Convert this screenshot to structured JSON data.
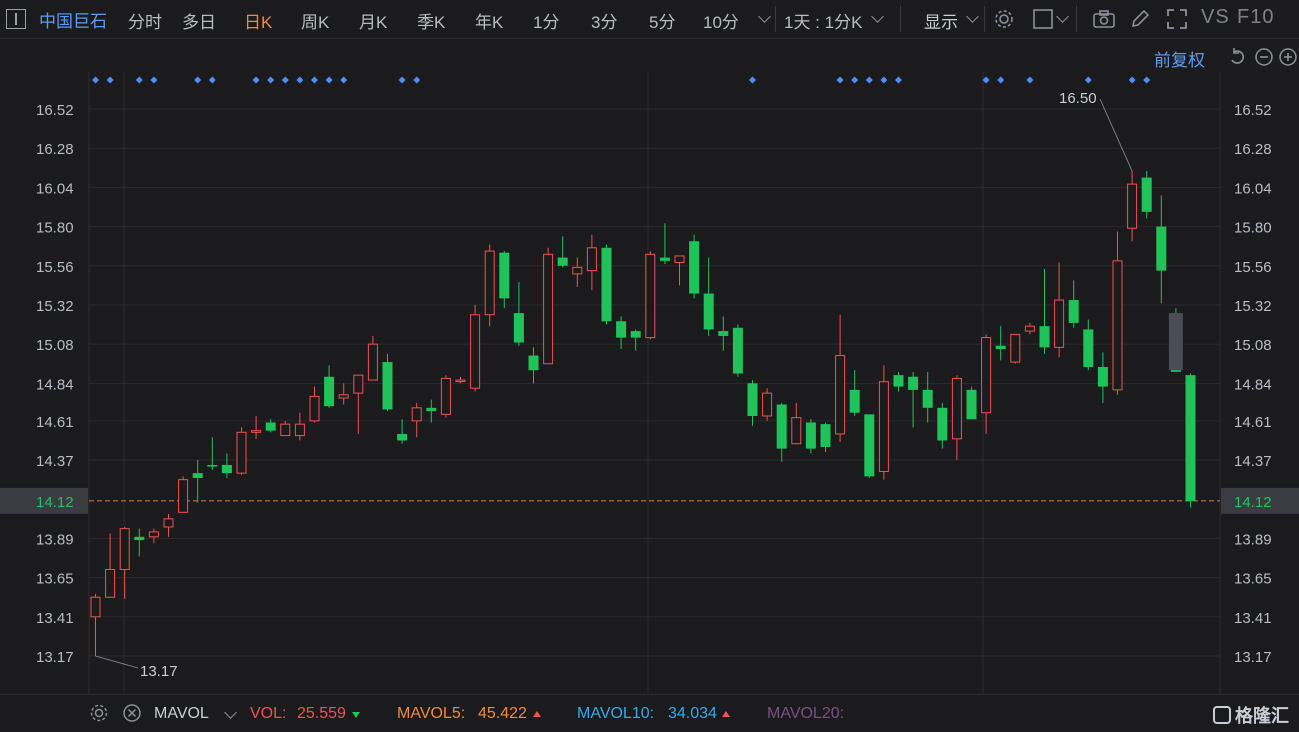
{
  "toolbar": {
    "stock_name": "中国巨石",
    "tabs": [
      "分时",
      "多日",
      "日K",
      "周K",
      "月K",
      "季K",
      "年K",
      "1分",
      "3分",
      "5分",
      "10分"
    ],
    "active_tab": "日K",
    "period_selector": "1天 : 1分K",
    "display_label": "显示",
    "vs_label": "VS",
    "f10_label": "F10"
  },
  "subheader": {
    "adjust_label": "前复权"
  },
  "colors": {
    "up": "#f0524f",
    "down": "#1fc35a",
    "grid": "#2a2b2f",
    "marker": "#4f8ef7",
    "price_line": "#e07b39",
    "price_tag_bg": "#3a3c42"
  },
  "chart_data": {
    "type": "candlestick",
    "y_ticks": [
      "16.52",
      "16.28",
      "16.04",
      "15.80",
      "15.56",
      "15.32",
      "15.08",
      "14.84",
      "14.61",
      "14.37",
      "14.12",
      "13.89",
      "13.65",
      "13.41",
      "13.17"
    ],
    "ylim": [
      13.06,
      16.69
    ],
    "current_price": "14.12",
    "high_label": "16.50",
    "low_label": "13.17",
    "marker_columns": [
      0,
      1,
      3,
      4,
      7,
      8,
      11,
      12,
      13,
      14,
      15,
      16,
      17,
      21,
      22,
      45,
      51,
      52,
      53,
      54,
      55,
      61,
      62,
      64,
      68,
      71,
      72
    ],
    "candles": [
      {
        "o": 13.41,
        "h": 13.55,
        "l": 13.17,
        "c": 13.53
      },
      {
        "o": 13.53,
        "h": 13.92,
        "l": 13.53,
        "c": 13.7
      },
      {
        "o": 13.7,
        "h": 13.96,
        "l": 13.52,
        "c": 13.95
      },
      {
        "o": 13.9,
        "h": 13.95,
        "l": 13.78,
        "c": 13.88
      },
      {
        "o": 13.9,
        "h": 13.95,
        "l": 13.86,
        "c": 13.93
      },
      {
        "o": 13.96,
        "h": 14.04,
        "l": 13.9,
        "c": 14.01
      },
      {
        "o": 14.05,
        "h": 14.27,
        "l": 14.05,
        "c": 14.25
      },
      {
        "o": 14.29,
        "h": 14.37,
        "l": 14.11,
        "c": 14.26
      },
      {
        "o": 14.34,
        "h": 14.51,
        "l": 14.31,
        "c": 14.33
      },
      {
        "o": 14.34,
        "h": 14.41,
        "l": 14.26,
        "c": 14.29
      },
      {
        "o": 14.29,
        "h": 14.57,
        "l": 14.28,
        "c": 14.54
      },
      {
        "o": 14.54,
        "h": 14.64,
        "l": 14.5,
        "c": 14.55
      },
      {
        "o": 14.6,
        "h": 14.62,
        "l": 14.54,
        "c": 14.55
      },
      {
        "o": 14.52,
        "h": 14.61,
        "l": 14.52,
        "c": 14.59
      },
      {
        "o": 14.52,
        "h": 14.66,
        "l": 14.49,
        "c": 14.59
      },
      {
        "o": 14.61,
        "h": 14.82,
        "l": 14.6,
        "c": 14.76
      },
      {
        "o": 14.88,
        "h": 14.95,
        "l": 14.69,
        "c": 14.7
      },
      {
        "o": 14.75,
        "h": 14.84,
        "l": 14.71,
        "c": 14.77
      },
      {
        "o": 14.78,
        "h": 14.89,
        "l": 14.53,
        "c": 14.89
      },
      {
        "o": 14.86,
        "h": 15.13,
        "l": 14.86,
        "c": 15.08
      },
      {
        "o": 14.97,
        "h": 15.02,
        "l": 14.67,
        "c": 14.68
      },
      {
        "o": 14.53,
        "h": 14.62,
        "l": 14.47,
        "c": 14.49
      },
      {
        "o": 14.61,
        "h": 14.72,
        "l": 14.51,
        "c": 14.69
      },
      {
        "o": 14.69,
        "h": 14.74,
        "l": 14.6,
        "c": 14.67
      },
      {
        "o": 14.65,
        "h": 14.89,
        "l": 14.63,
        "c": 14.87
      },
      {
        "o": 14.86,
        "h": 14.88,
        "l": 14.84,
        "c": 14.86
      },
      {
        "o": 14.81,
        "h": 15.32,
        "l": 14.79,
        "c": 15.26
      },
      {
        "o": 15.26,
        "h": 15.69,
        "l": 15.19,
        "c": 15.65
      },
      {
        "o": 15.64,
        "h": 15.65,
        "l": 15.3,
        "c": 15.36
      },
      {
        "o": 15.27,
        "h": 15.46,
        "l": 15.07,
        "c": 15.09
      },
      {
        "o": 15.01,
        "h": 15.06,
        "l": 14.84,
        "c": 14.92
      },
      {
        "o": 14.96,
        "h": 15.67,
        "l": 14.96,
        "c": 15.63
      },
      {
        "o": 15.61,
        "h": 15.74,
        "l": 15.55,
        "c": 15.56
      },
      {
        "o": 15.51,
        "h": 15.61,
        "l": 15.43,
        "c": 15.55
      },
      {
        "o": 15.53,
        "h": 15.75,
        "l": 15.41,
        "c": 15.67
      },
      {
        "o": 15.67,
        "h": 15.69,
        "l": 15.2,
        "c": 15.22
      },
      {
        "o": 15.22,
        "h": 15.25,
        "l": 15.05,
        "c": 15.12
      },
      {
        "o": 15.16,
        "h": 15.17,
        "l": 15.04,
        "c": 15.12
      },
      {
        "o": 15.12,
        "h": 15.65,
        "l": 15.11,
        "c": 15.63
      },
      {
        "o": 15.61,
        "h": 15.82,
        "l": 15.57,
        "c": 15.59
      },
      {
        "o": 15.58,
        "h": 15.61,
        "l": 15.44,
        "c": 15.62
      },
      {
        "o": 15.71,
        "h": 15.75,
        "l": 15.36,
        "c": 15.39
      },
      {
        "o": 15.39,
        "h": 15.61,
        "l": 15.13,
        "c": 15.17
      },
      {
        "o": 15.16,
        "h": 15.25,
        "l": 15.04,
        "c": 15.13
      },
      {
        "o": 15.18,
        "h": 15.2,
        "l": 14.88,
        "c": 14.9
      },
      {
        "o": 14.84,
        "h": 14.86,
        "l": 14.58,
        "c": 14.64
      },
      {
        "o": 14.64,
        "h": 14.81,
        "l": 14.61,
        "c": 14.78
      },
      {
        "o": 14.71,
        "h": 14.72,
        "l": 14.36,
        "c": 14.44
      },
      {
        "o": 14.47,
        "h": 14.72,
        "l": 14.47,
        "c": 14.63
      },
      {
        "o": 14.6,
        "h": 14.62,
        "l": 14.41,
        "c": 14.44
      },
      {
        "o": 14.59,
        "h": 14.6,
        "l": 14.42,
        "c": 14.45
      },
      {
        "o": 14.53,
        "h": 15.26,
        "l": 14.48,
        "c": 15.01
      },
      {
        "o": 14.8,
        "h": 14.92,
        "l": 14.64,
        "c": 14.66
      },
      {
        "o": 14.65,
        "h": 14.65,
        "l": 14.26,
        "c": 14.27
      },
      {
        "o": 14.3,
        "h": 14.95,
        "l": 14.25,
        "c": 14.85
      },
      {
        "o": 14.89,
        "h": 14.91,
        "l": 14.79,
        "c": 14.82
      },
      {
        "o": 14.88,
        "h": 14.91,
        "l": 14.57,
        "c": 14.8
      },
      {
        "o": 14.8,
        "h": 14.91,
        "l": 14.6,
        "c": 14.69
      },
      {
        "o": 14.69,
        "h": 14.72,
        "l": 14.44,
        "c": 14.49
      },
      {
        "o": 14.5,
        "h": 14.89,
        "l": 14.37,
        "c": 14.87
      },
      {
        "o": 14.8,
        "h": 14.82,
        "l": 14.62,
        "c": 14.62
      },
      {
        "o": 14.66,
        "h": 15.14,
        "l": 14.53,
        "c": 15.12
      },
      {
        "o": 15.07,
        "h": 15.19,
        "l": 14.98,
        "c": 15.05
      },
      {
        "o": 14.97,
        "h": 15.14,
        "l": 14.96,
        "c": 15.14
      },
      {
        "o": 15.16,
        "h": 15.21,
        "l": 15.14,
        "c": 15.19
      },
      {
        "o": 15.19,
        "h": 15.54,
        "l": 15.02,
        "c": 15.06
      },
      {
        "o": 15.06,
        "h": 15.58,
        "l": 15.0,
        "c": 15.35
      },
      {
        "o": 15.35,
        "h": 15.47,
        "l": 15.18,
        "c": 15.21
      },
      {
        "o": 15.17,
        "h": 15.23,
        "l": 14.92,
        "c": 14.94
      },
      {
        "o": 14.94,
        "h": 15.03,
        "l": 14.72,
        "c": 14.82
      },
      {
        "o": 14.8,
        "h": 15.77,
        "l": 14.77,
        "c": 15.59
      },
      {
        "o": 15.79,
        "h": 16.14,
        "l": 15.71,
        "c": 16.06
      },
      {
        "o": 16.1,
        "h": 16.14,
        "l": 15.85,
        "c": 15.89
      },
      {
        "o": 15.8,
        "h": 15.99,
        "l": 15.33,
        "c": 15.53
      },
      {
        "o": 15.25,
        "h": 15.3,
        "l": 14.94,
        "c": 14.91
      },
      {
        "o": 14.89,
        "h": 14.9,
        "l": 14.08,
        "c": 14.12
      }
    ]
  },
  "volume_bar": {
    "mavol_label": "MAVOL",
    "vol_label": "VOL:",
    "vol_value": "25.559",
    "mavol5_label": "MAVOL5:",
    "mavol5_value": "45.422",
    "mavol10_label": "MAVOL10:",
    "mavol10_value": "34.034",
    "mavol20_label": "MAVOL20:",
    "brand": "格隆汇"
  }
}
